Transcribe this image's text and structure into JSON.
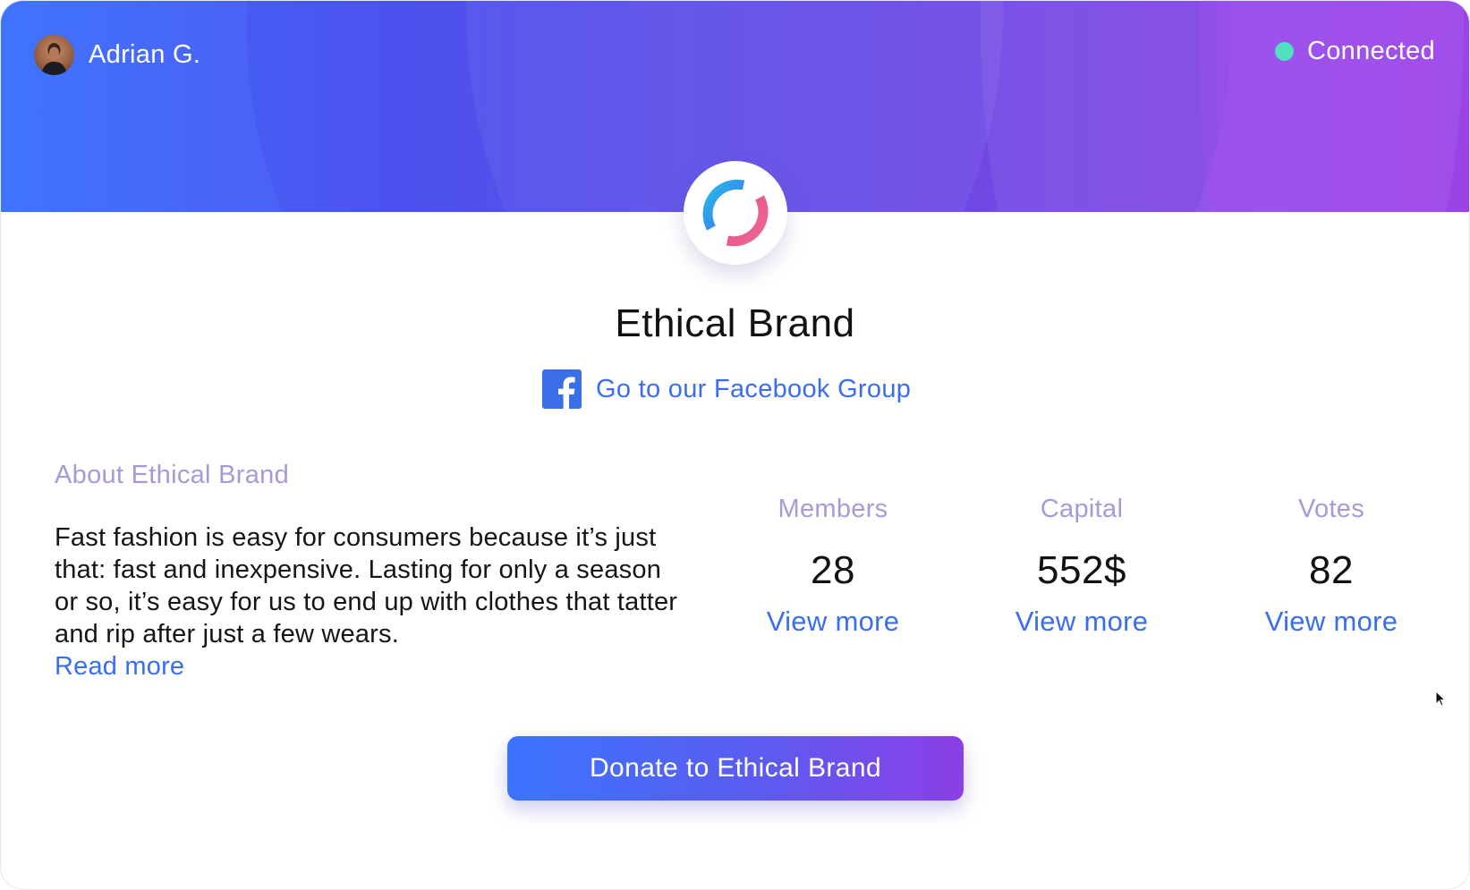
{
  "user": {
    "name": "Adrian G.",
    "avatar_icon": "user-avatar"
  },
  "status": {
    "label": "Connected",
    "color": "#4fe0c0"
  },
  "brand": {
    "name": "Ethical Brand",
    "logo_icon": "ring-logo-icon",
    "facebook_link_label": "Go to our Facebook Group",
    "facebook_icon": "facebook-icon"
  },
  "about": {
    "heading": "About Ethical Brand",
    "text": "Fast fashion is easy for consumers because it’s just that: fast and inexpensive. Lasting for only a season or so, it’s easy for us to end up with clothes that tatter and rip after just a few wears.",
    "read_more": "Read more"
  },
  "stats": [
    {
      "label": "Members",
      "value": "28",
      "link": "View more"
    },
    {
      "label": "Capital",
      "value": "552$",
      "link": "View more"
    },
    {
      "label": "Votes",
      "value": "82",
      "link": "View more"
    }
  ],
  "donate_button": {
    "label": "Donate to Ethical Brand"
  },
  "colors": {
    "accent": "#3a6ef0",
    "muted_heading": "#a79ad8",
    "gradient_start": "#3f74ff",
    "gradient_end": "#9b43e6"
  }
}
